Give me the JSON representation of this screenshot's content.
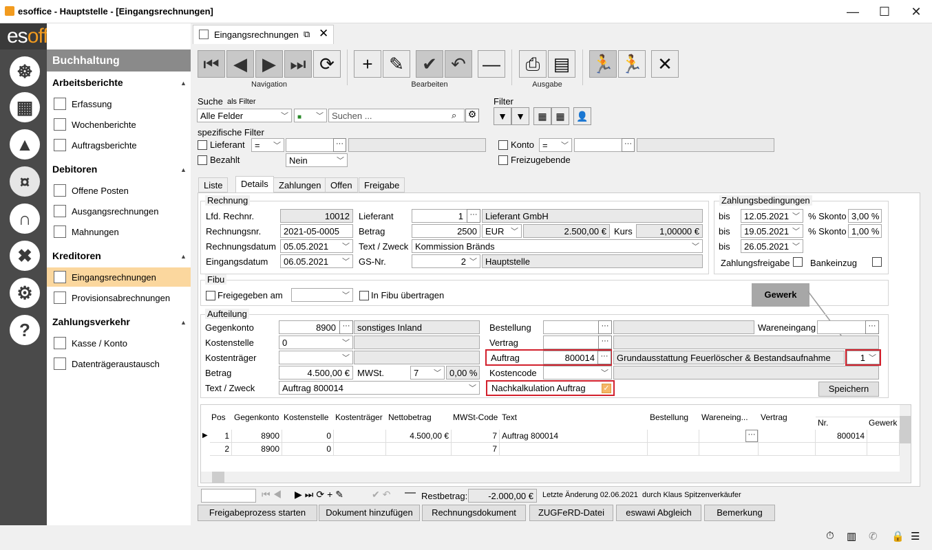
{
  "window": {
    "title": "esoffice - Hauptstelle - [Eingangsrechnungen]"
  },
  "logo": {
    "es": "es",
    "office": "office"
  },
  "nav": {
    "header": "Buchhaltung",
    "sections": [
      {
        "title": "Arbeitsberichte",
        "items": [
          "Erfassung",
          "Wochenberichte",
          "Auftragsberichte"
        ]
      },
      {
        "title": "Debitoren",
        "items": [
          "Offene Posten",
          "Ausgangsrechnungen",
          "Mahnungen"
        ]
      },
      {
        "title": "Kreditoren",
        "items": [
          "Eingangsrechnungen",
          "Provisionsabrechnungen"
        ]
      },
      {
        "title": "Zahlungsverkehr",
        "items": [
          "Kasse / Konto",
          "Datenträgeraustausch"
        ]
      }
    ]
  },
  "doc_tab": {
    "label": "Eingangsrechnungen"
  },
  "toolbar": {
    "navigation": "Navigation",
    "bearbeiten": "Bearbeiten",
    "ausgabe": "Ausgabe"
  },
  "search": {
    "label": "Suche",
    "als_filter": "als Filter",
    "field": "Alle Felder",
    "placeholder": "Suchen ...",
    "filter_label": "Filter",
    "specific": "spezifische Filter",
    "lieferant": "Lieferant",
    "op1": "=",
    "bezahlt": "Bezahlt",
    "bezahlt_val": "Nein",
    "konto": "Konto",
    "op2": "=",
    "freizugebende": "Freizugebende"
  },
  "tabs": [
    "Liste",
    "Details",
    "Zahlungen",
    "Offen",
    "Freigabe"
  ],
  "rechnung": {
    "legend": "Rechnung",
    "lfd_label": "Lfd. Rechnr.",
    "lfd": "10012",
    "nr_label": "Rechnungsnr.",
    "nr": "2021-05-0005",
    "datum_label": "Rechnungsdatum",
    "datum": "05.05.2021",
    "eingang_label": "Eingangsdatum",
    "eingang": "06.05.2021",
    "lieferant_label": "Lieferant",
    "lieferant_nr": "1",
    "lieferant_name": "Lieferant GmbH",
    "betrag_label": "Betrag",
    "betrag": "2500",
    "waehrung": "EUR",
    "betrag_eur": "2.500,00 €",
    "kurs_label": "Kurs",
    "kurs": "1,00000 €",
    "text_label": "Text / Zweck",
    "text": "Kommission Bränds",
    "gs_label": "GS-Nr.",
    "gs": "2",
    "gs_name": "Hauptstelle"
  },
  "zahlung": {
    "legend": "Zahlungsbedingungen",
    "bis": "bis",
    "rows": [
      {
        "date": "12.05.2021",
        "sk_label": "% Skonto",
        "sk": "3,00 %"
      },
      {
        "date": "19.05.2021",
        "sk_label": "% Skonto",
        "sk": "1,00 %"
      },
      {
        "date": "26.05.2021"
      }
    ],
    "freigabe": "Zahlungsfreigabe",
    "bankeinzug": "Bankeinzug"
  },
  "fibu": {
    "legend": "Fibu",
    "freigegeben": "Freigegeben am",
    "uebertragen": "In Fibu übertragen"
  },
  "callout": {
    "label": "Gewerk"
  },
  "aufteilung": {
    "legend": "Aufteilung",
    "gegenkonto_label": "Gegenkonto",
    "gegenkonto": "8900",
    "gegenkonto_name": "sonstiges Inland",
    "kostenstelle_label": "Kostenstelle",
    "kostenstelle": "0",
    "kostentraeger_label": "Kostenträger",
    "betrag_label": "Betrag",
    "betrag": "4.500,00 €",
    "mwst_label": "MWSt.",
    "mwst": "7",
    "mwst_pct": "0,00 %",
    "text_label": "Text / Zweck",
    "text": "Auftrag 800014",
    "bestellung_label": "Bestellung",
    "vertrag_label": "Vertrag",
    "wareneingang_label": "Wareneingang",
    "auftrag_label": "Auftrag",
    "auftrag": "800014",
    "auftrag_name": "Grundausstattung Feuerlöscher & Bestandsaufnahme",
    "gewerk": "1",
    "kostencode_label": "Kostencode",
    "nachkalk": "Nachkalkulation Auftrag",
    "speichern": "Speichern"
  },
  "grid": {
    "headers": [
      "Pos",
      "Gegenkonto",
      "Kostenstelle",
      "Kostenträger",
      "Nettobetrag",
      "MWSt-Code",
      "Text",
      "Bestellung",
      "Wareneing...",
      "Vertrag",
      "Nr.",
      "Gewerk"
    ],
    "rows": [
      {
        "pos": "1",
        "gk": "8900",
        "ks": "0",
        "netto": "4.500,00 €",
        "mwst": "7",
        "text": "Auftrag 800014",
        "nr": "800014"
      },
      {
        "pos": "2",
        "gk": "8900",
        "ks": "0",
        "netto": "",
        "mwst": "7",
        "text": "",
        "nr": ""
      }
    ]
  },
  "footer": {
    "restbetrag_label": "Restbetrag:",
    "restbetrag": "-2.000,00 €",
    "aenderung": "Letzte Änderung 02.06.2021  durch Klaus Spitzenverkäufer"
  },
  "buttons": [
    "Freigabeprozess starten",
    "Dokument hinzufügen",
    "Rechnungsdokument",
    "ZUGFeRD-Datei",
    "eswawi Abgleich",
    "Bemerkung"
  ]
}
